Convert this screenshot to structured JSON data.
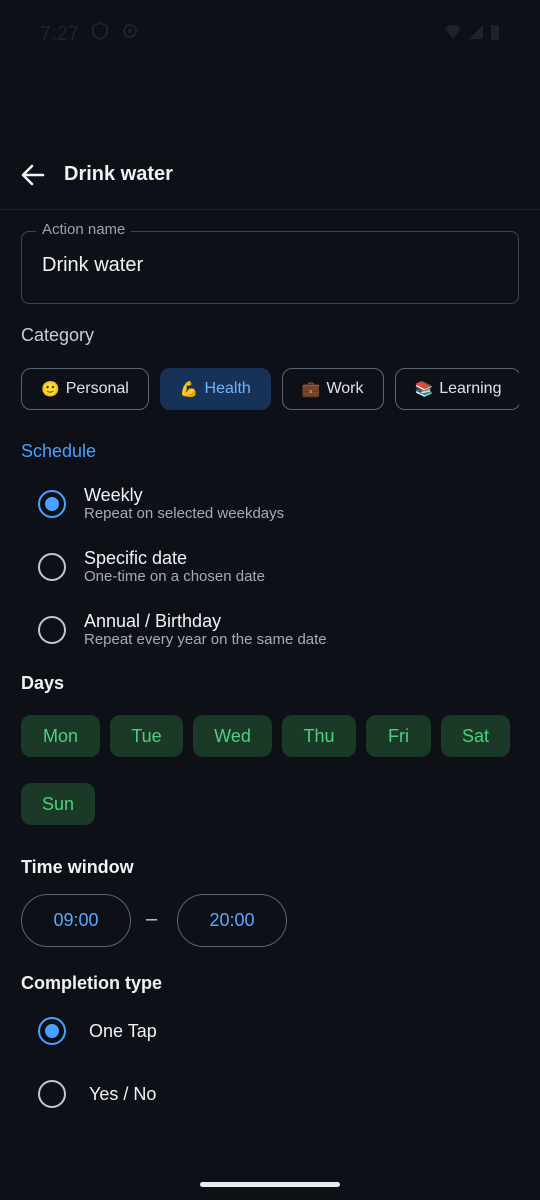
{
  "status_bar": {
    "time": "7:27"
  },
  "app_bar": {
    "title": "Drink water"
  },
  "action_name": {
    "label": "Action name",
    "value": "Drink water"
  },
  "category": {
    "label": "Category",
    "chips": [
      {
        "emoji": "🙂",
        "label": "Personal",
        "selected": false
      },
      {
        "emoji": "💪",
        "label": "Health",
        "selected": true
      },
      {
        "emoji": "💼",
        "label": "Work",
        "selected": false
      },
      {
        "emoji": "📚",
        "label": "Learning",
        "selected": false
      }
    ]
  },
  "schedule": {
    "label": "Schedule",
    "options": [
      {
        "title": "Weekly",
        "subtitle": "Repeat on selected weekdays",
        "selected": true
      },
      {
        "title": "Specific date",
        "subtitle": "One-time on a chosen date",
        "selected": false
      },
      {
        "title": "Annual / Birthday",
        "subtitle": "Repeat every year on the same date",
        "selected": false
      }
    ]
  },
  "days": {
    "label": "Days",
    "items": [
      "Mon",
      "Tue",
      "Wed",
      "Thu",
      "Fri",
      "Sat",
      "Sun"
    ]
  },
  "time_window": {
    "label": "Time window",
    "start": "09:00",
    "separator": "–",
    "end": "20:00"
  },
  "completion_type": {
    "label": "Completion type",
    "options": [
      {
        "label": "One Tap",
        "selected": true
      },
      {
        "label": "Yes / No",
        "selected": false
      }
    ]
  },
  "colors": {
    "background": "#0d1117",
    "accent": "#4aa0ff",
    "day_chip_bg": "#1a3a27",
    "day_chip_text": "#4ed07e",
    "selected_chip_bg": "#163259"
  }
}
